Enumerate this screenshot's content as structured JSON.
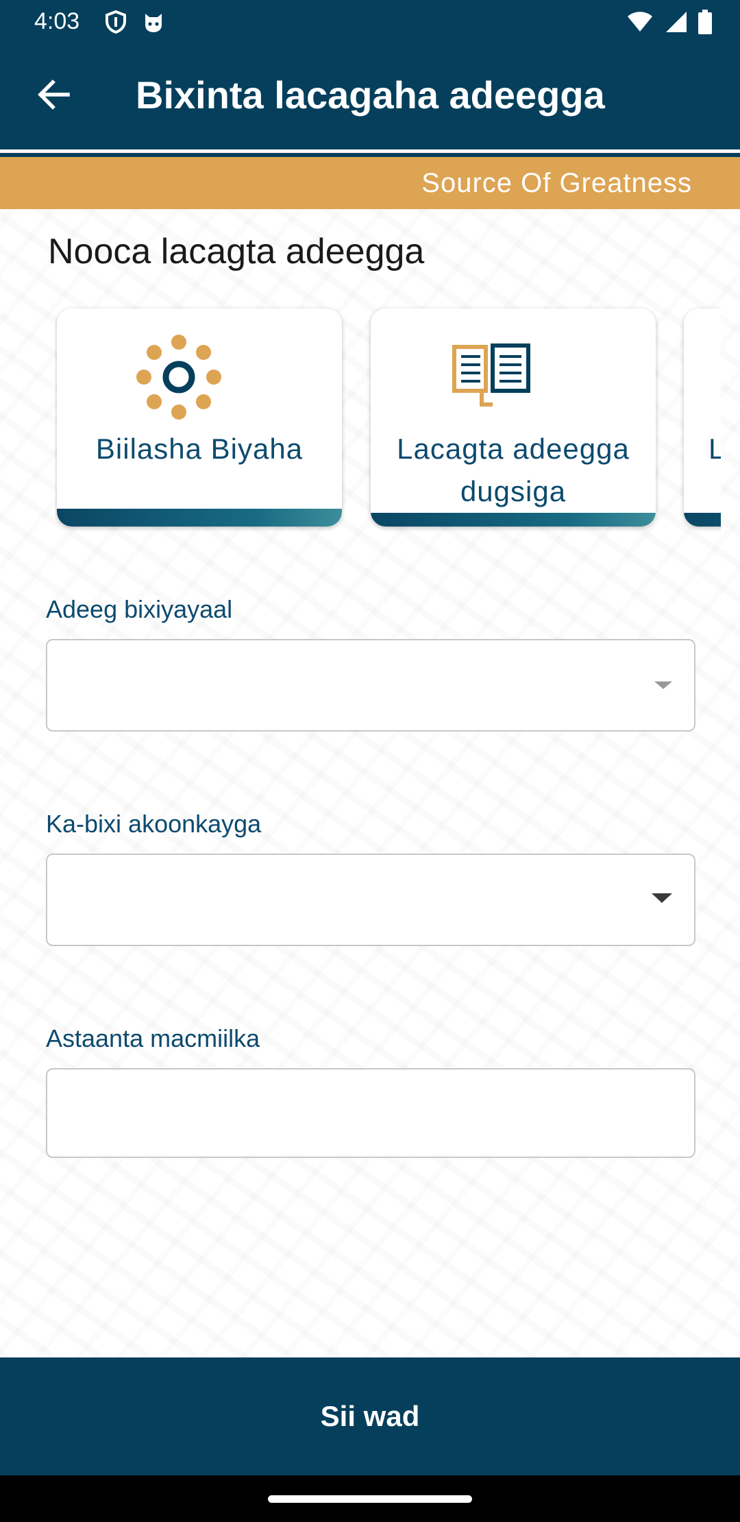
{
  "status_bar": {
    "time": "4:03",
    "left_icons": [
      "shield-icon",
      "cat-face-icon"
    ],
    "right_icons": [
      "wifi-icon",
      "signal-icon",
      "battery-icon"
    ]
  },
  "header": {
    "back_icon": "arrow-left-icon",
    "title": "Bixinta lacagaha adeegga"
  },
  "banner": {
    "text": "Source Of Greatness"
  },
  "section": {
    "title": "Nooca lacagta adeegga"
  },
  "service_types": [
    {
      "label": "Biilasha Biyaha",
      "icon": "dots-ring-icon"
    },
    {
      "label_line1": "Lacagta adeegga",
      "label_line2": "dugsiga",
      "icon": "open-book-icon"
    },
    {
      "label": "L",
      "icon": ""
    }
  ],
  "form": {
    "provider": {
      "label": "Adeeg bixiyayaal",
      "value": ""
    },
    "account": {
      "label": "Ka-bixi akoonkayga",
      "value": ""
    },
    "customer_ref": {
      "label": "Astaanta macmiilka",
      "value": ""
    }
  },
  "submit": {
    "label": "Sii wad"
  },
  "colors": {
    "primary": "#053f5c",
    "accent": "#dda453",
    "text_primary": "#0c4a6e"
  }
}
